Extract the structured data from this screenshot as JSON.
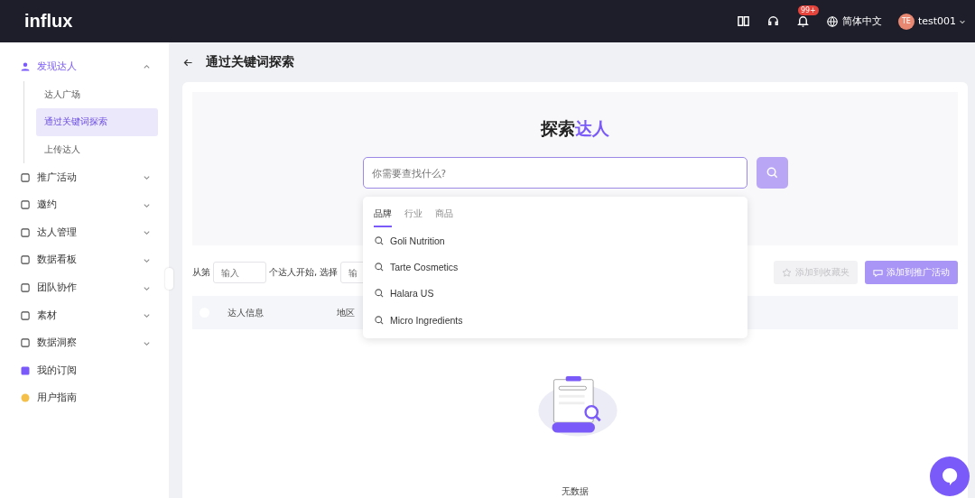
{
  "header": {
    "logo": "influx",
    "badge": "99+",
    "language": "简体中文",
    "avatar": "TE",
    "user": "test001"
  },
  "sidebar": {
    "items": [
      {
        "label": "发现达人",
        "expanded": true,
        "selected": true,
        "children": [
          {
            "label": "达人广场",
            "selected": false
          },
          {
            "label": "通过关键词探索",
            "selected": true
          },
          {
            "label": "上传达人",
            "selected": false
          }
        ]
      },
      {
        "label": "推广活动",
        "expanded": false,
        "selected": false
      },
      {
        "label": "邀约",
        "expanded": false,
        "selected": false
      },
      {
        "label": "达人管理",
        "expanded": false,
        "selected": false
      },
      {
        "label": "数据看板",
        "expanded": false,
        "selected": false
      },
      {
        "label": "团队协作",
        "expanded": false,
        "selected": false
      },
      {
        "label": "素材",
        "expanded": false,
        "selected": false
      },
      {
        "label": "数据洞察",
        "expanded": false,
        "selected": false
      },
      {
        "label": "我的订阅",
        "selected": false
      },
      {
        "label": "用户指南",
        "selected": false
      }
    ]
  },
  "page": {
    "title": "通过关键词探索"
  },
  "hero": {
    "title_parts": [
      {
        "text": "探索",
        "highlight": false
      },
      {
        "text": "达人",
        "highlight": true
      }
    ],
    "search": {
      "placeholder": "你需要查找什么?"
    }
  },
  "dropdown": {
    "tabs": [
      {
        "label": "品牌",
        "selected": true
      },
      {
        "label": "行业",
        "selected": false
      },
      {
        "label": "商品",
        "selected": false
      }
    ],
    "items": [
      "Goli Nutrition",
      "Tarte Cosmetics",
      "Halara US",
      "Micro Ingredients"
    ]
  },
  "toolbar": {
    "prefix": "从第",
    "start_placeholder": "输入",
    "middle": "个达人开始, 选择",
    "count_placeholder": "输",
    "buttons": [
      {
        "label": "添加到收藏夹",
        "disabled": true
      },
      {
        "label": "添加到推广活动",
        "disabled": false
      }
    ]
  },
  "table": {
    "select_all": {
      "checked": false
    },
    "columns": [
      "达人信息",
      "地区"
    ],
    "empty": "无数据"
  }
}
